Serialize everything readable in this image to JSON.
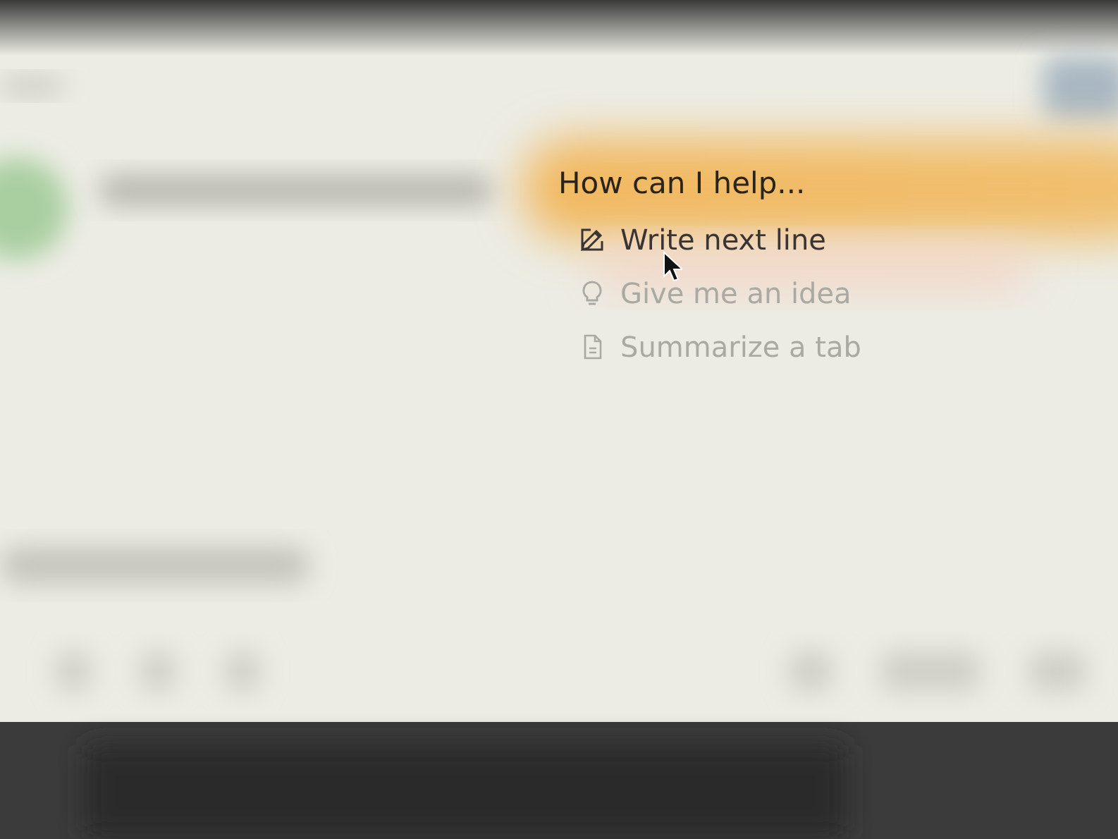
{
  "prompt": {
    "title": "How can I help..."
  },
  "menu": [
    {
      "label": "Write next line",
      "kind": "pencil",
      "selected": true
    },
    {
      "label": "Give me an idea",
      "kind": "bulb",
      "selected": false
    },
    {
      "label": "Summarize a tab",
      "kind": "doc",
      "selected": false
    }
  ]
}
